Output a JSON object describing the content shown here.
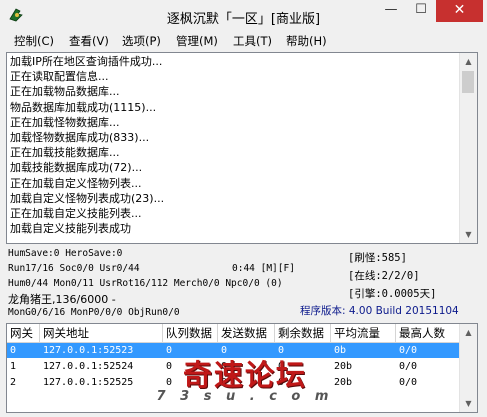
{
  "window": {
    "title": "逐枫沉默「一区」[商业版]"
  },
  "title_buttons": {
    "minimize": "—",
    "maximize": "☐",
    "close": "✕"
  },
  "menu": [
    {
      "label": "控制(C)"
    },
    {
      "label": "查看(V)"
    },
    {
      "label": "选项(P)"
    },
    {
      "label": "管理(M)"
    },
    {
      "label": "工具(T)"
    },
    {
      "label": "帮助(H)"
    }
  ],
  "log": [
    "加载IP所在地区查询插件成功...",
    "正在读取配置信息...",
    "正在加载物品数据库...",
    "物品数据库加载成功(1115)...",
    "正在加载怪物数据库...",
    "加载怪物数据库成功(833)...",
    "正在加载技能数据库...",
    "加载技能数据库成功(72)...",
    "正在加载自定义怪物列表...",
    "加载自定义怪物列表成功(23)...",
    "正在加载自定义技能列表...",
    "加载自定义技能列表成功"
  ],
  "status": {
    "save_line": "HumSave:0 HeroSave:0",
    "run_line": "Run17/16 Soc0/0 Usr0/44",
    "timer": "0:44 [M][F]",
    "hum_line": "Hum0/44 Mon0/11 UsrRot16/112 Merch0/0 Npc0/0 (0)",
    "map_line": "龙角猪王,136/6000 -",
    "mon_line": "MonG0/6/16 MonP0/0/0 ObjRun0/0",
    "refresh": "[刷怪:585]",
    "online": "[在线:2/2/0]",
    "interval": "[引擎:0.0005天]",
    "version": "程序版本: 4.00 Build 20151104"
  },
  "table": {
    "columns": [
      "网关",
      "网关地址",
      "队列数据",
      "发送数据",
      "剩余数据",
      "平均流量",
      "最高人数"
    ],
    "rows": [
      [
        "0",
        "127.0.0.1:52523",
        "0",
        "0",
        "0",
        "0b",
        "0/0"
      ],
      [
        "1",
        "127.0.0.1:52524",
        "0",
        "0",
        "0",
        "20b",
        "0/0"
      ],
      [
        "2",
        "127.0.0.1:52525",
        "0",
        "0",
        "0",
        "20b",
        "0/0"
      ]
    ],
    "selected_row": 0
  },
  "watermark": {
    "main": "奇速论坛",
    "sub": "7 3 s u . c o m"
  },
  "colors": {
    "selection": "#3399ff",
    "version_text": "#0c1a8c",
    "close_button": "#c7302f"
  }
}
